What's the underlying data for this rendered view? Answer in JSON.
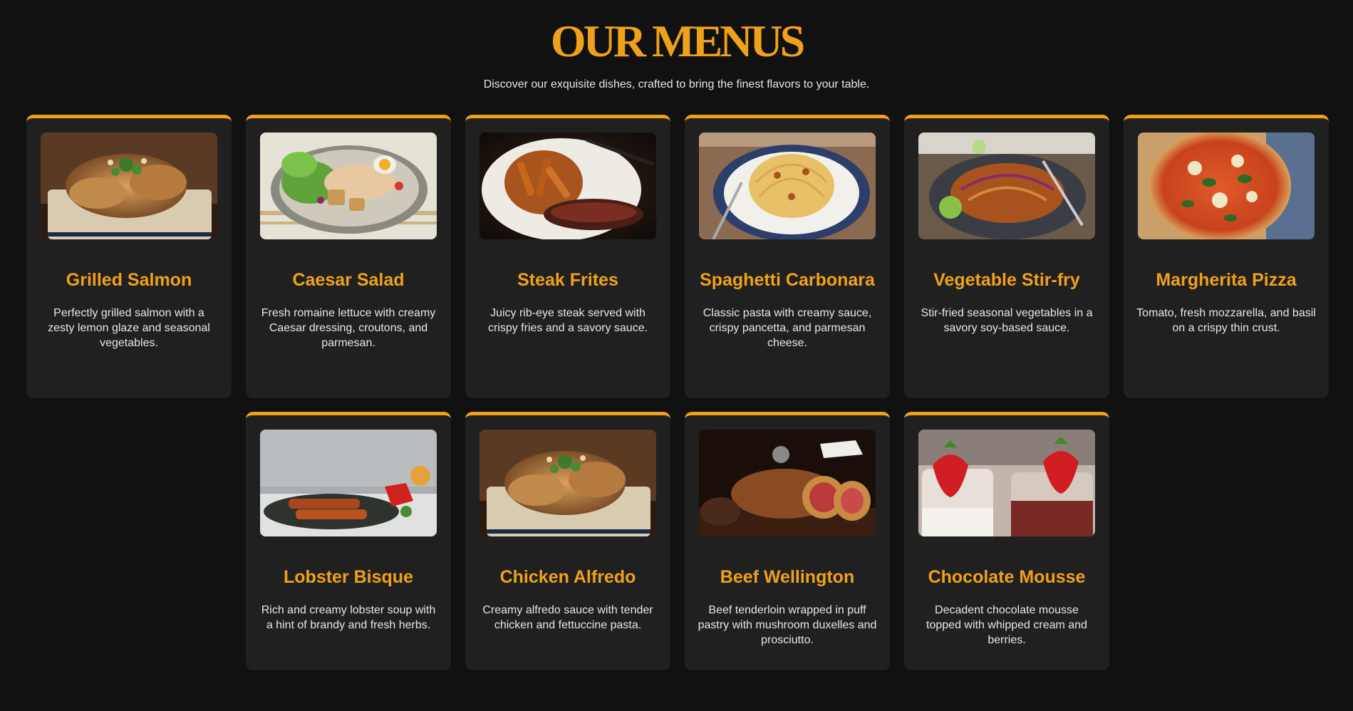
{
  "header": {
    "title": "OUR MENUS",
    "subtitle": "Discover our exquisite dishes, crafted to bring the finest flavors to your table."
  },
  "colors": {
    "accent": "#f0a11a",
    "background": "#111111",
    "card": "#202020",
    "text": "#e6e6e6"
  },
  "menu": [
    {
      "name": "Grilled Salmon",
      "description": "Perfectly grilled salmon with a zesty lemon glaze and seasonal vegetables.",
      "image": "roasted-chicken-photo"
    },
    {
      "name": "Caesar Salad",
      "description": "Fresh romaine lettuce with creamy Caesar dressing, croutons, and parmesan.",
      "image": "caesar-salad-photo"
    },
    {
      "name": "Steak Frites",
      "description": "Juicy rib-eye steak served with crispy fries and a savory sauce.",
      "image": "steak-frites-photo"
    },
    {
      "name": "Spaghetti Carbonara",
      "description": "Classic pasta with creamy sauce, crispy pancetta, and parmesan cheese.",
      "image": "spaghetti-photo"
    },
    {
      "name": "Vegetable Stir-fry",
      "description": "Stir-fried seasonal vegetables in a savory soy-based sauce.",
      "image": "stir-fry-photo"
    },
    {
      "name": "Margherita Pizza",
      "description": "Tomato, fresh mozzarella, and basil on a crispy thin crust.",
      "image": "pizza-photo"
    },
    {
      "name": "Lobster Bisque",
      "description": "Rich and creamy lobster soup with a hint of brandy and fresh herbs.",
      "image": "skewers-photo"
    },
    {
      "name": "Chicken Alfredo",
      "description": "Creamy alfredo sauce with tender chicken and fettuccine pasta.",
      "image": "roasted-chicken-photo"
    },
    {
      "name": "Beef Wellington",
      "description": "Beef tenderloin wrapped in puff pastry with mushroom duxelles and prosciutto.",
      "image": "beef-wellington-photo"
    },
    {
      "name": "Chocolate Mousse",
      "description": "Decadent chocolate mousse topped with whipped cream and berries.",
      "image": "strawberry-dessert-photo"
    }
  ]
}
